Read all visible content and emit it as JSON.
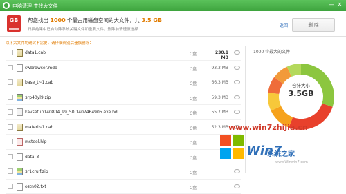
{
  "window": {
    "title": "电脑清理-查找大文件",
    "min": "—",
    "close": "✕"
  },
  "header": {
    "icon_label": "GB",
    "summary_prefix": "帮您找出",
    "file_count": "1000",
    "summary_middle": "个最占用磁盘空间的大文件，共",
    "total_size": "3.5 GB",
    "sub": "扫描结果中已启动除系统关键文件和重要文件，删除前请谨慎选择",
    "back_label": "返回",
    "delete_label": "删 除"
  },
  "hint": "以下大文件均确实不需要，请仔细辨别后谨慎删除：",
  "files": [
    {
      "name": "data1.cab",
      "drive": "C盘",
      "size": "230.1 MB",
      "type": "cab",
      "bold": true
    },
    {
      "name": "swbrowser.mdb",
      "drive": "C盘",
      "size": "93.3 MB",
      "type": "file",
      "bold": false
    },
    {
      "name": "base_t~1.cab",
      "drive": "C盘",
      "size": "66.3 MB",
      "type": "cab",
      "bold": false
    },
    {
      "name": "$rp40yl9.zip",
      "drive": "C盘",
      "size": "59.3 MB",
      "type": "zip",
      "bold": false
    },
    {
      "name": "kavsetup140804_99_50.1407464905.exe.bdl",
      "drive": "C盘",
      "size": "55.7 MB",
      "type": "exe",
      "bold": false
    },
    {
      "name": "materi~1.cab",
      "drive": "C盘",
      "size": "52.3 MB",
      "type": "cab",
      "bold": false
    },
    {
      "name": "msteel.hlp",
      "drive": "C盘",
      "size": "",
      "type": "hlp",
      "bold": false
    },
    {
      "name": "data_3",
      "drive": "C盘",
      "size": "",
      "type": "file",
      "bold": false
    },
    {
      "name": "$r1crulf.zip",
      "drive": "C盘",
      "size": "",
      "type": "zip",
      "bold": false
    },
    {
      "name": "ostn02.txt",
      "drive": "C盘",
      "size": "",
      "type": "file",
      "bold": false
    }
  ],
  "chart": {
    "title": "1000 个最大的文件",
    "center_label": "合计大小",
    "center_value": "3.5GB",
    "segments": [
      {
        "fraction": 0.3,
        "color": "#8cc63f"
      },
      {
        "fraction": 0.26,
        "color": "#e8412c"
      },
      {
        "fraction": 0.12,
        "color": "#f6a21c"
      },
      {
        "fraction": 0.09,
        "color": "#f7c83a"
      },
      {
        "fraction": 0.08,
        "color": "#ef6c3a"
      },
      {
        "fraction": 0.08,
        "color": "#f29a3a"
      },
      {
        "fraction": 0.07,
        "color": "#b4d95c"
      }
    ]
  },
  "watermark": {
    "site": "www.win7zhijia.cn",
    "brand": "Win7",
    "slogan": "系统之家",
    "url": "www.Winwin7.com"
  },
  "colors": {
    "accent": "#3ea43e",
    "highlight": "#e07b00",
    "danger": "#d9322e"
  }
}
